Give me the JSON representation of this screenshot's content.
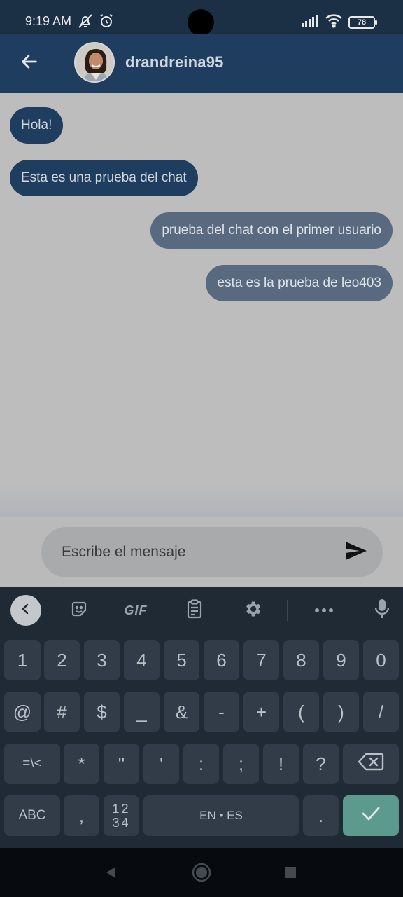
{
  "status_bar": {
    "time": "9:19 AM",
    "battery": "78"
  },
  "header": {
    "contact_name": "drandreina95"
  },
  "messages": [
    {
      "text": "Hola!",
      "direction": "incoming"
    },
    {
      "text": "Esta es una prueba del chat",
      "direction": "incoming"
    },
    {
      "text": "prueba del chat con el primer usuario",
      "direction": "outgoing"
    },
    {
      "text": "esta es la prueba de leo403",
      "direction": "outgoing"
    }
  ],
  "composer": {
    "placeholder": "Escribe el mensaje",
    "value": ""
  },
  "keyboard": {
    "toolbar": {
      "gif_label": "GIF"
    },
    "row1": [
      "1",
      "2",
      "3",
      "4",
      "5",
      "6",
      "7",
      "8",
      "9",
      "0"
    ],
    "row2": [
      "@",
      "#",
      "$",
      "_",
      "&",
      "-",
      "+",
      "(",
      ")",
      "/"
    ],
    "row3": [
      "=\\<",
      "*",
      "\"",
      "'",
      ":",
      ";",
      "!",
      "?"
    ],
    "row4": {
      "abc": "ABC",
      "comma": ",",
      "num_top": "12",
      "num_bottom": "34",
      "space": "EN • ES",
      "period": "."
    }
  },
  "colors": {
    "app_bar": "#1f3d5e",
    "incoming_bubble": "#1f3d5e",
    "outgoing_bubble": "#596a80",
    "enter_key": "#5d9a8e"
  }
}
